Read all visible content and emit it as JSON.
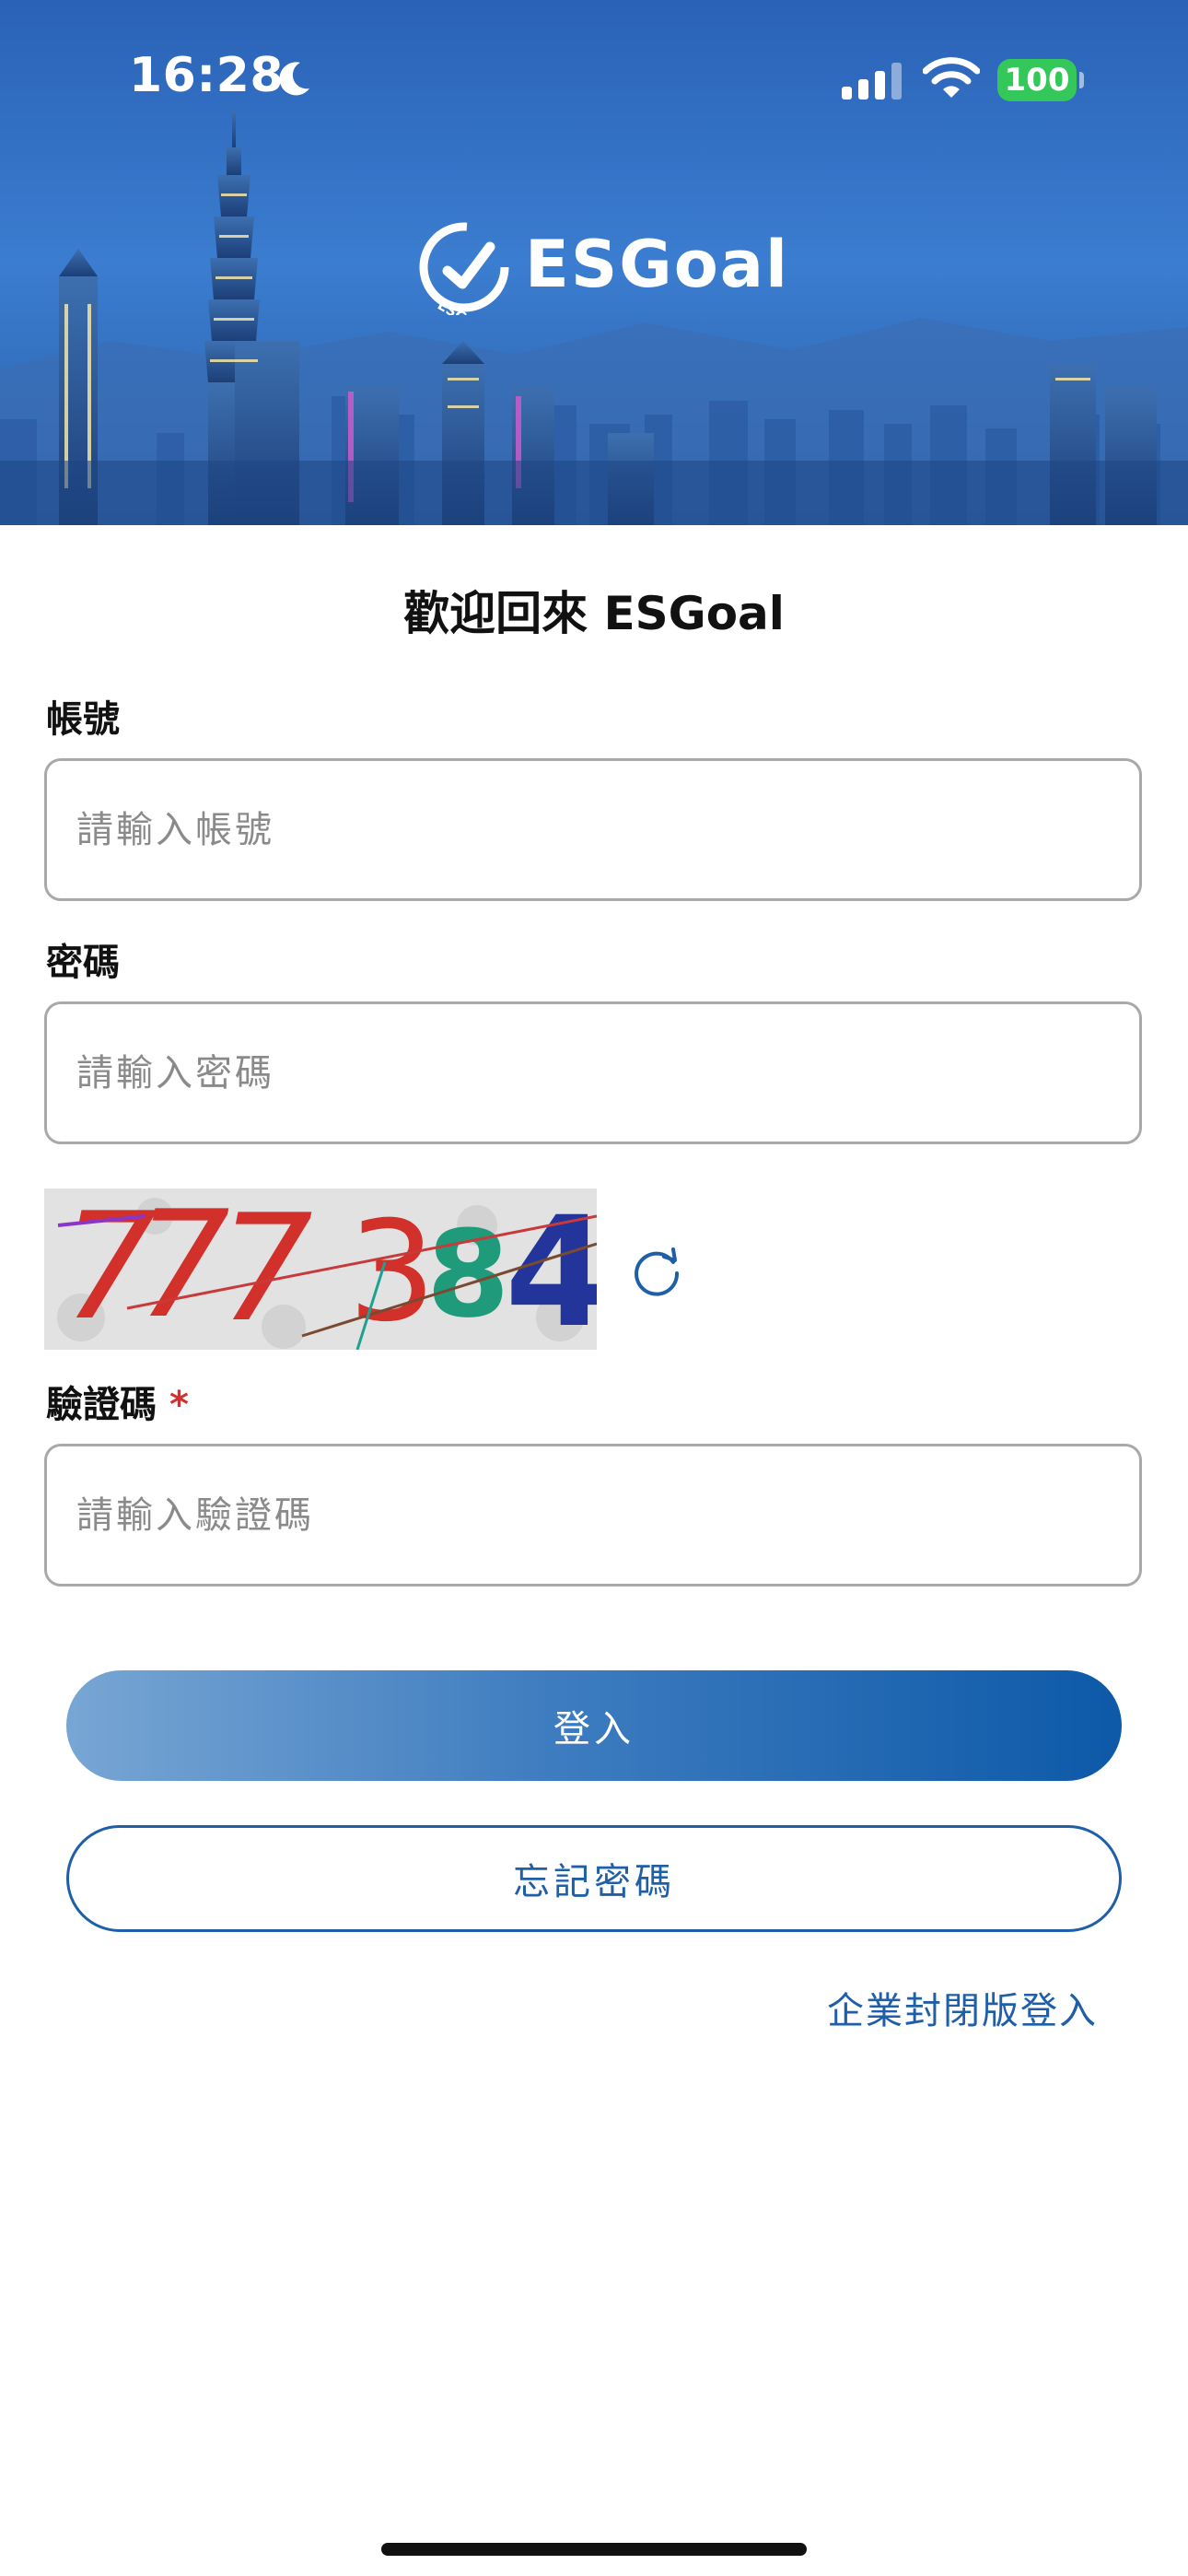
{
  "status_bar": {
    "time": "16:28",
    "battery": "100",
    "moon_icon": "moon-icon",
    "signal_icon": "cellular-signal-icon",
    "wifi_icon": "wifi-icon"
  },
  "header": {
    "logo_text": "ESGoal",
    "logo_icon": "esgoal-logo-icon",
    "logo_ring_text": "ESGoal"
  },
  "form": {
    "title": "歡迎回來 ESGoal",
    "account": {
      "label": "帳號",
      "placeholder": "請輸入帳號",
      "value": ""
    },
    "password": {
      "label": "密碼",
      "placeholder": "請輸入密碼",
      "value": ""
    },
    "captcha": {
      "image_text": "777384",
      "refresh_icon": "refresh-icon",
      "label": "驗證碼",
      "required_mark": "*",
      "placeholder": "請輸入驗證碼",
      "value": ""
    }
  },
  "actions": {
    "login_label": "登入",
    "forgot_label": "忘記密碼",
    "enterprise_login_label": "企業封閉版登入"
  },
  "colors": {
    "primary": "#1f5fa8",
    "required": "#d32f2f",
    "battery": "#34c759"
  }
}
